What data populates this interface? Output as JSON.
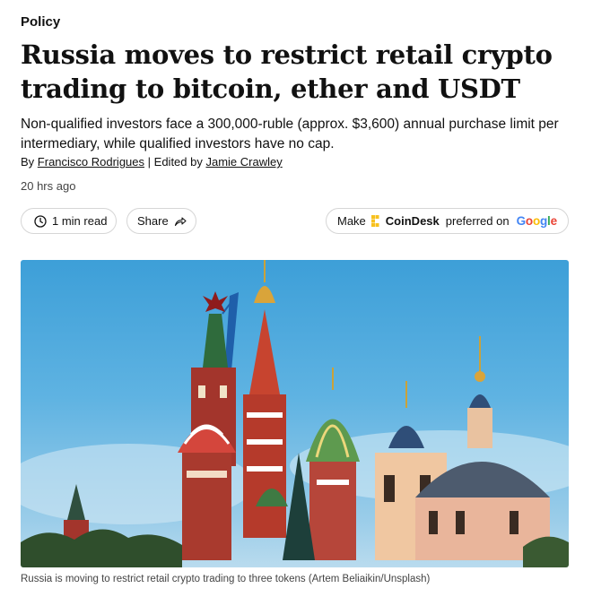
{
  "article": {
    "category": "Policy",
    "headline": "Russia moves to restrict retail crypto trading to bitcoin, ether and USDT",
    "dek": "Non-qualified investors face a 300,000-ruble (approx. $3,600) annual purchase limit per intermediary, while qualified investors have no cap.",
    "byline": {
      "prefix": "By",
      "author": "Francisco Rodrigues",
      "separator": "|",
      "edited_prefix": "Edited by",
      "editor": "Jamie Crawley"
    },
    "timestamp": "20 hrs ago"
  },
  "actions": {
    "read_time": "1 min read",
    "share_label": "Share",
    "preferred": {
      "make_label": "Make",
      "brand": "CoinDesk",
      "preferred_label": "preferred on",
      "google_letters": [
        "G",
        "o",
        "o",
        "g",
        "l",
        "e"
      ],
      "google_colors": [
        "#4285F4",
        "#EA4335",
        "#FBBC05",
        "#4285F4",
        "#34A853",
        "#EA4335"
      ]
    }
  },
  "image": {
    "caption": "Russia is moving to restrict retail crypto trading to three tokens (Artem Beliaikin/Unsplash)"
  },
  "icons": {
    "clock": "clock-icon",
    "share": "share-arrow-icon",
    "coindesk": "coindesk-logo-icon"
  },
  "colors": {
    "coindesk_yellow": "#F7C11E",
    "sky": "#4aa6dc"
  }
}
